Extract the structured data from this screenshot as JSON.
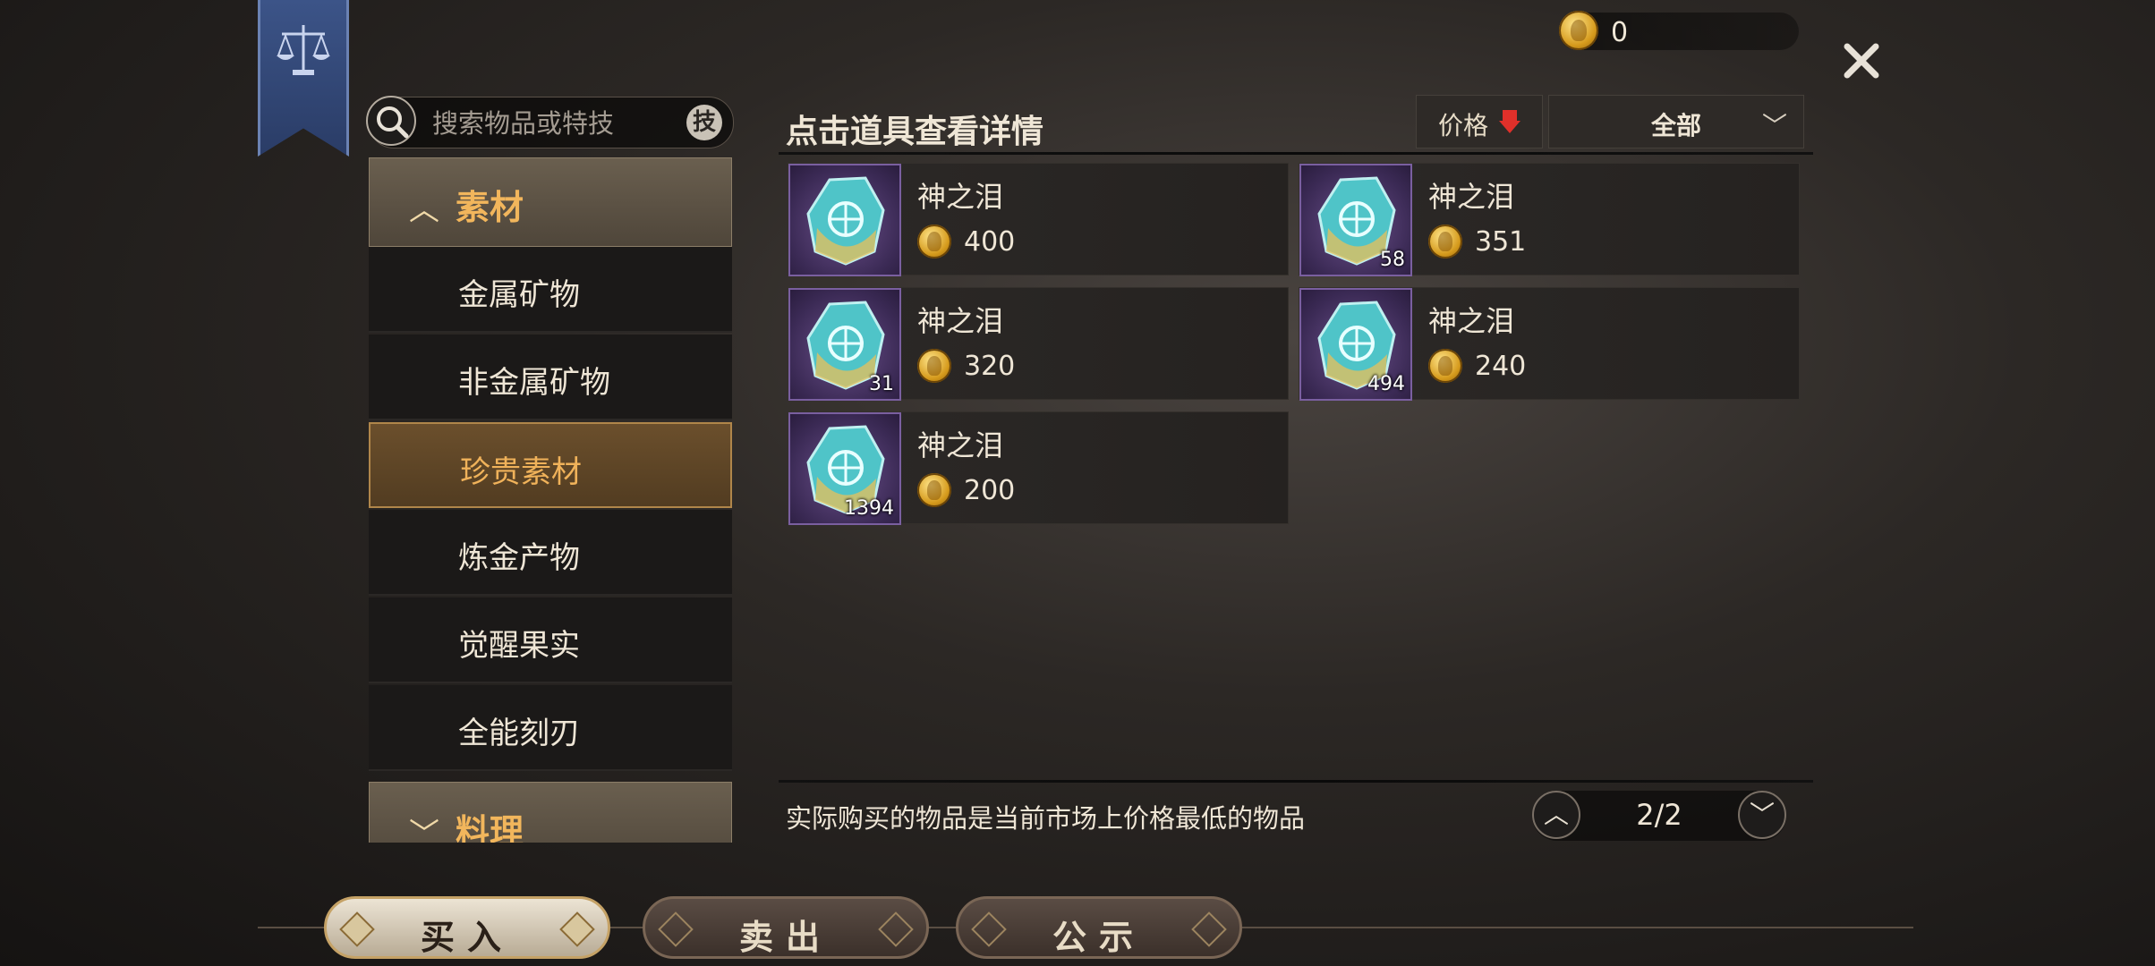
{
  "currency": {
    "amount": "0"
  },
  "search": {
    "placeholder": "搜索物品或特技",
    "skill_label": "技"
  },
  "categories": {
    "group_open": {
      "label": "素材"
    },
    "items": [
      {
        "label": "金属矿物"
      },
      {
        "label": "非金属矿物"
      },
      {
        "label": "珍贵素材",
        "selected": true
      },
      {
        "label": "炼金产物"
      },
      {
        "label": "觉醒果实"
      },
      {
        "label": "全能刻刃"
      }
    ],
    "group_closed": {
      "label": "料理"
    }
  },
  "main": {
    "heading": "点击道具查看详情",
    "sort_label": "价格",
    "filter_label": "全部",
    "note": "实际购买的物品是当前市场上价格最低的物品",
    "page": "2/2"
  },
  "listings": [
    {
      "name": "神之泪",
      "price": "400",
      "qty": ""
    },
    {
      "name": "神之泪",
      "price": "351",
      "qty": "58"
    },
    {
      "name": "神之泪",
      "price": "320",
      "qty": "31"
    },
    {
      "name": "神之泪",
      "price": "240",
      "qty": "494"
    },
    {
      "name": "神之泪",
      "price": "200",
      "qty": "1394"
    }
  ],
  "tabs": [
    {
      "label": "买入",
      "active": true
    },
    {
      "label": "卖出"
    },
    {
      "label": "公示"
    }
  ],
  "colors": {
    "accent": "#f2b65c",
    "sort_arrow": "#e0302a",
    "item_frame": "#7a5fa0"
  }
}
